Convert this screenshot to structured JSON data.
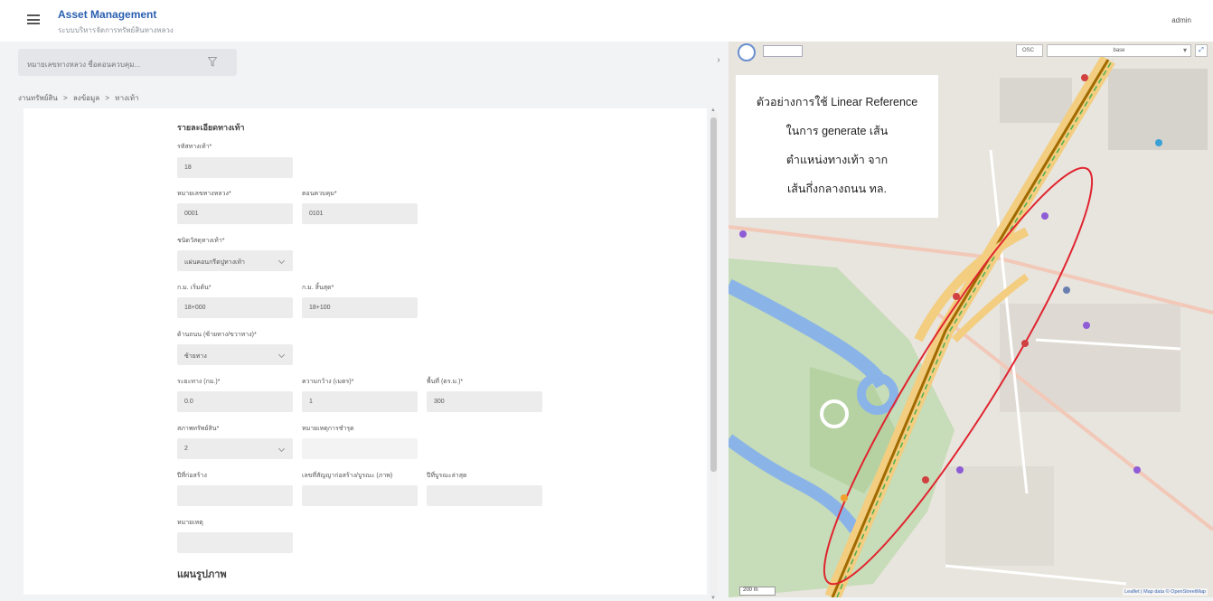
{
  "header": {
    "title": "Asset Management",
    "subtitle": "ระบบบริหารจัดการทรัพย์สินทางหลวง",
    "user": "admin"
  },
  "filter": {
    "placeholder": "หมายเลขทางหลวง ชื่อตอนควบคุม..."
  },
  "breadcrumb": [
    "งานทรัพย์สิน",
    ">",
    "ลงข้อมูล",
    ">",
    "ทางเท้า"
  ],
  "form": {
    "section_title": "รายละเอียดทางเท้า",
    "fields": {
      "id": {
        "label": "รหัสทางเท้า*",
        "value": "18"
      },
      "route": {
        "label": "หมายเลขทางหลวง*",
        "value": "0001"
      },
      "section": {
        "label": "ตอนควบคุม*",
        "value": "0101"
      },
      "type": {
        "label": "ชนิดวัสดุทางเท้า*",
        "value": "แผ่นคอนกรีตปูทางเท้า"
      },
      "km_start": {
        "label": "ก.ม. เริ่มต้น*",
        "value": "18+000"
      },
      "km_end": {
        "label": "ก.ม. สิ้นสุด*",
        "value": "18+100"
      },
      "side": {
        "label": "ด้านถนน (ซ้ายทาง/ขวาทาง)*",
        "value": "ซ้ายทาง"
      },
      "distance": {
        "label": "ระยะทาง (กม.)*",
        "value": "0.0"
      },
      "width": {
        "label": "ความกว้าง (เมตร)*",
        "value": "1"
      },
      "area": {
        "label": "พื้นที่ (ตร.ม.)*",
        "value": "300"
      },
      "condition": {
        "label": "สภาพทรัพย์สิน*",
        "value": "2"
      },
      "damage": {
        "label": "หมายเหตุการชำรุด",
        "value": ""
      },
      "year_built": {
        "label": "ปีที่ก่อสร้าง",
        "value": ""
      },
      "contract": {
        "label": "เลขที่สัญญาก่อสร้าง/บูรณะ (ภาพ)",
        "value": ""
      },
      "year_maint": {
        "label": "ปีที่บูรณะล่าสุด",
        "value": ""
      },
      "remark": {
        "label": "หมายเหตุ",
        "value": ""
      }
    },
    "photo_section_title": "แผนรูปภาพ"
  },
  "map": {
    "select_small": "OSC",
    "select_layer": "base",
    "note_lines": [
      "ตัวอย่างการใช้ Linear Reference",
      "ในการ generate เส้น",
      "ตำแหน่งทางเท้า จาก",
      "เส้นกึ่งกลางถนน ทล."
    ],
    "scale": "200 m",
    "attribution": "Leaflet | Map data © OpenStreetMap"
  },
  "colors": {
    "accent": "#2a5fb0",
    "highlight_ellipse": "#e0242f",
    "route_centerline": "#6a4a00"
  }
}
